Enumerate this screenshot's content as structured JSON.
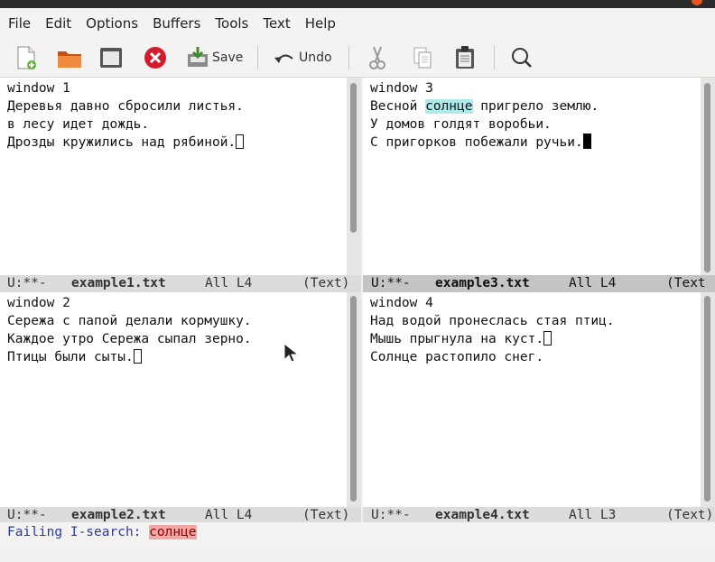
{
  "menubar": [
    "File",
    "Edit",
    "Options",
    "Buffers",
    "Tools",
    "Text",
    "Help"
  ],
  "toolbar": {
    "save_label": "Save",
    "undo_label": "Undo"
  },
  "windows": [
    {
      "lines": [
        "window 1",
        "Деревья давно сбросили листья.",
        "в лесу идет дождь.",
        "Дрозды кружились над рябиной."
      ],
      "modeline": {
        "status": "U:**-",
        "buffer": "example1.txt",
        "position": "All L4",
        "mode": "(Text)"
      }
    },
    {
      "lines": [
        "window 3",
        "Весной ",
        "солнце",
        " пригрело землю.",
        "У домов голдят воробьи.",
        "С пригорков побежали ручьи."
      ],
      "modeline": {
        "status": "U:**-",
        "buffer": "example3.txt",
        "position": "All L4",
        "mode": "(Text"
      }
    },
    {
      "lines": [
        "window 2",
        "Сережа с папой делали кормушку.",
        "Каждое утро Сережа сыпал зерно.",
        "Птицы были сыты."
      ],
      "modeline": {
        "status": "U:**-",
        "buffer": "example2.txt",
        "position": "All L4",
        "mode": "(Text)"
      }
    },
    {
      "lines": [
        "window 4",
        "Над водой пронеслась стая птиц.",
        "Мышь прыгнула на куст.",
        "Солнце растопило снег."
      ],
      "modeline": {
        "status": "U:**-",
        "buffer": "example4.txt",
        "position": "All L3",
        "mode": "(Text)"
      }
    }
  ],
  "minibuffer": {
    "prompt": "Failing I-search: ",
    "query": "солнце"
  }
}
